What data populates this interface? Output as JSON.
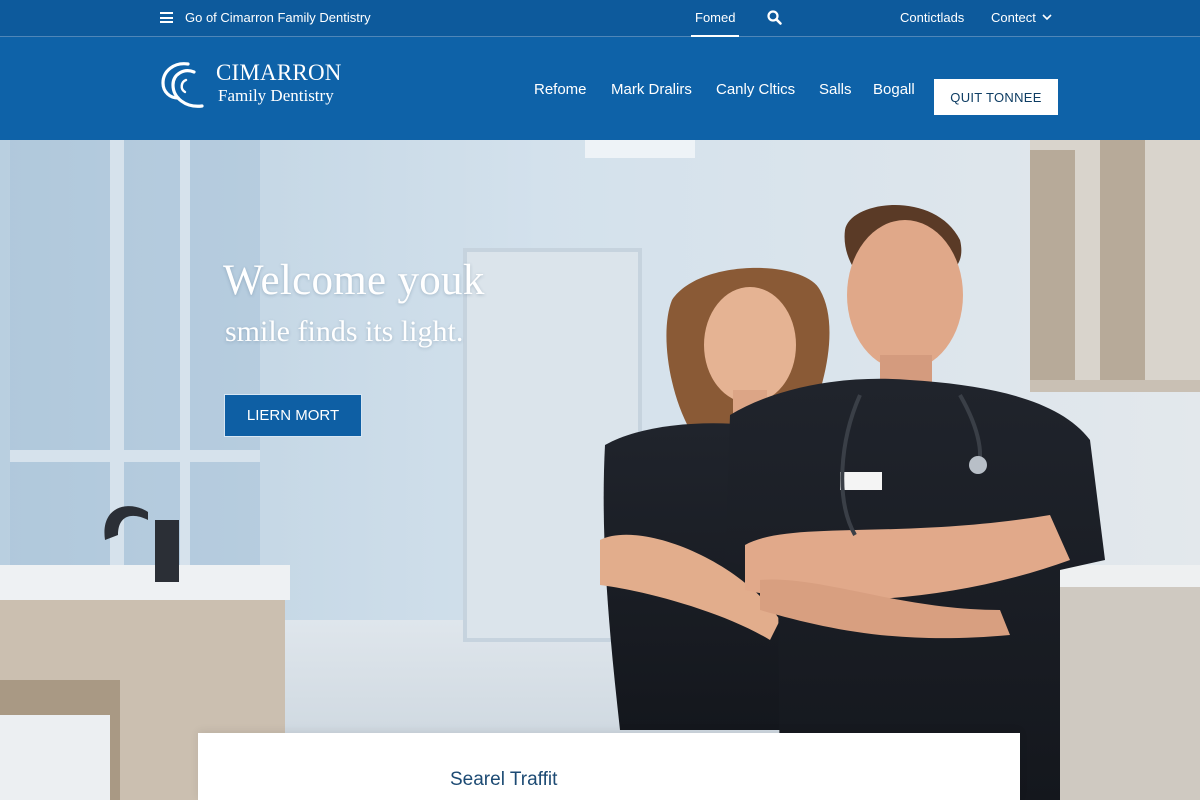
{
  "topbar": {
    "menu_label": "Go of Cimarron Family Dentistry",
    "home_tab": "Fomed",
    "link_a": "Contictlads",
    "link_b": "Contect"
  },
  "header": {
    "logo_name": "CIMARRON",
    "logo_sub": "Family Dentistry",
    "nav": [
      "Refome",
      "Mark Dralirs",
      "Canly Cltics",
      "Salls",
      "Bogall"
    ],
    "cta": "QUIT TONNEE"
  },
  "hero": {
    "title": "Welcome youk",
    "subtitle": "smile finds its light.",
    "button": "LIERN MORT"
  },
  "card": {
    "title": "Searel Traffit"
  },
  "colors": {
    "topbar": "#0d5a9c",
    "header": "#0e62a8",
    "accent_button": "#0e5fa4",
    "card_title": "#1c4a73"
  },
  "icons": {
    "menu": "hamburger-icon",
    "search": "search-icon",
    "dropdown": "chevron-down-icon",
    "logo": "cimarron-logo-mark"
  }
}
